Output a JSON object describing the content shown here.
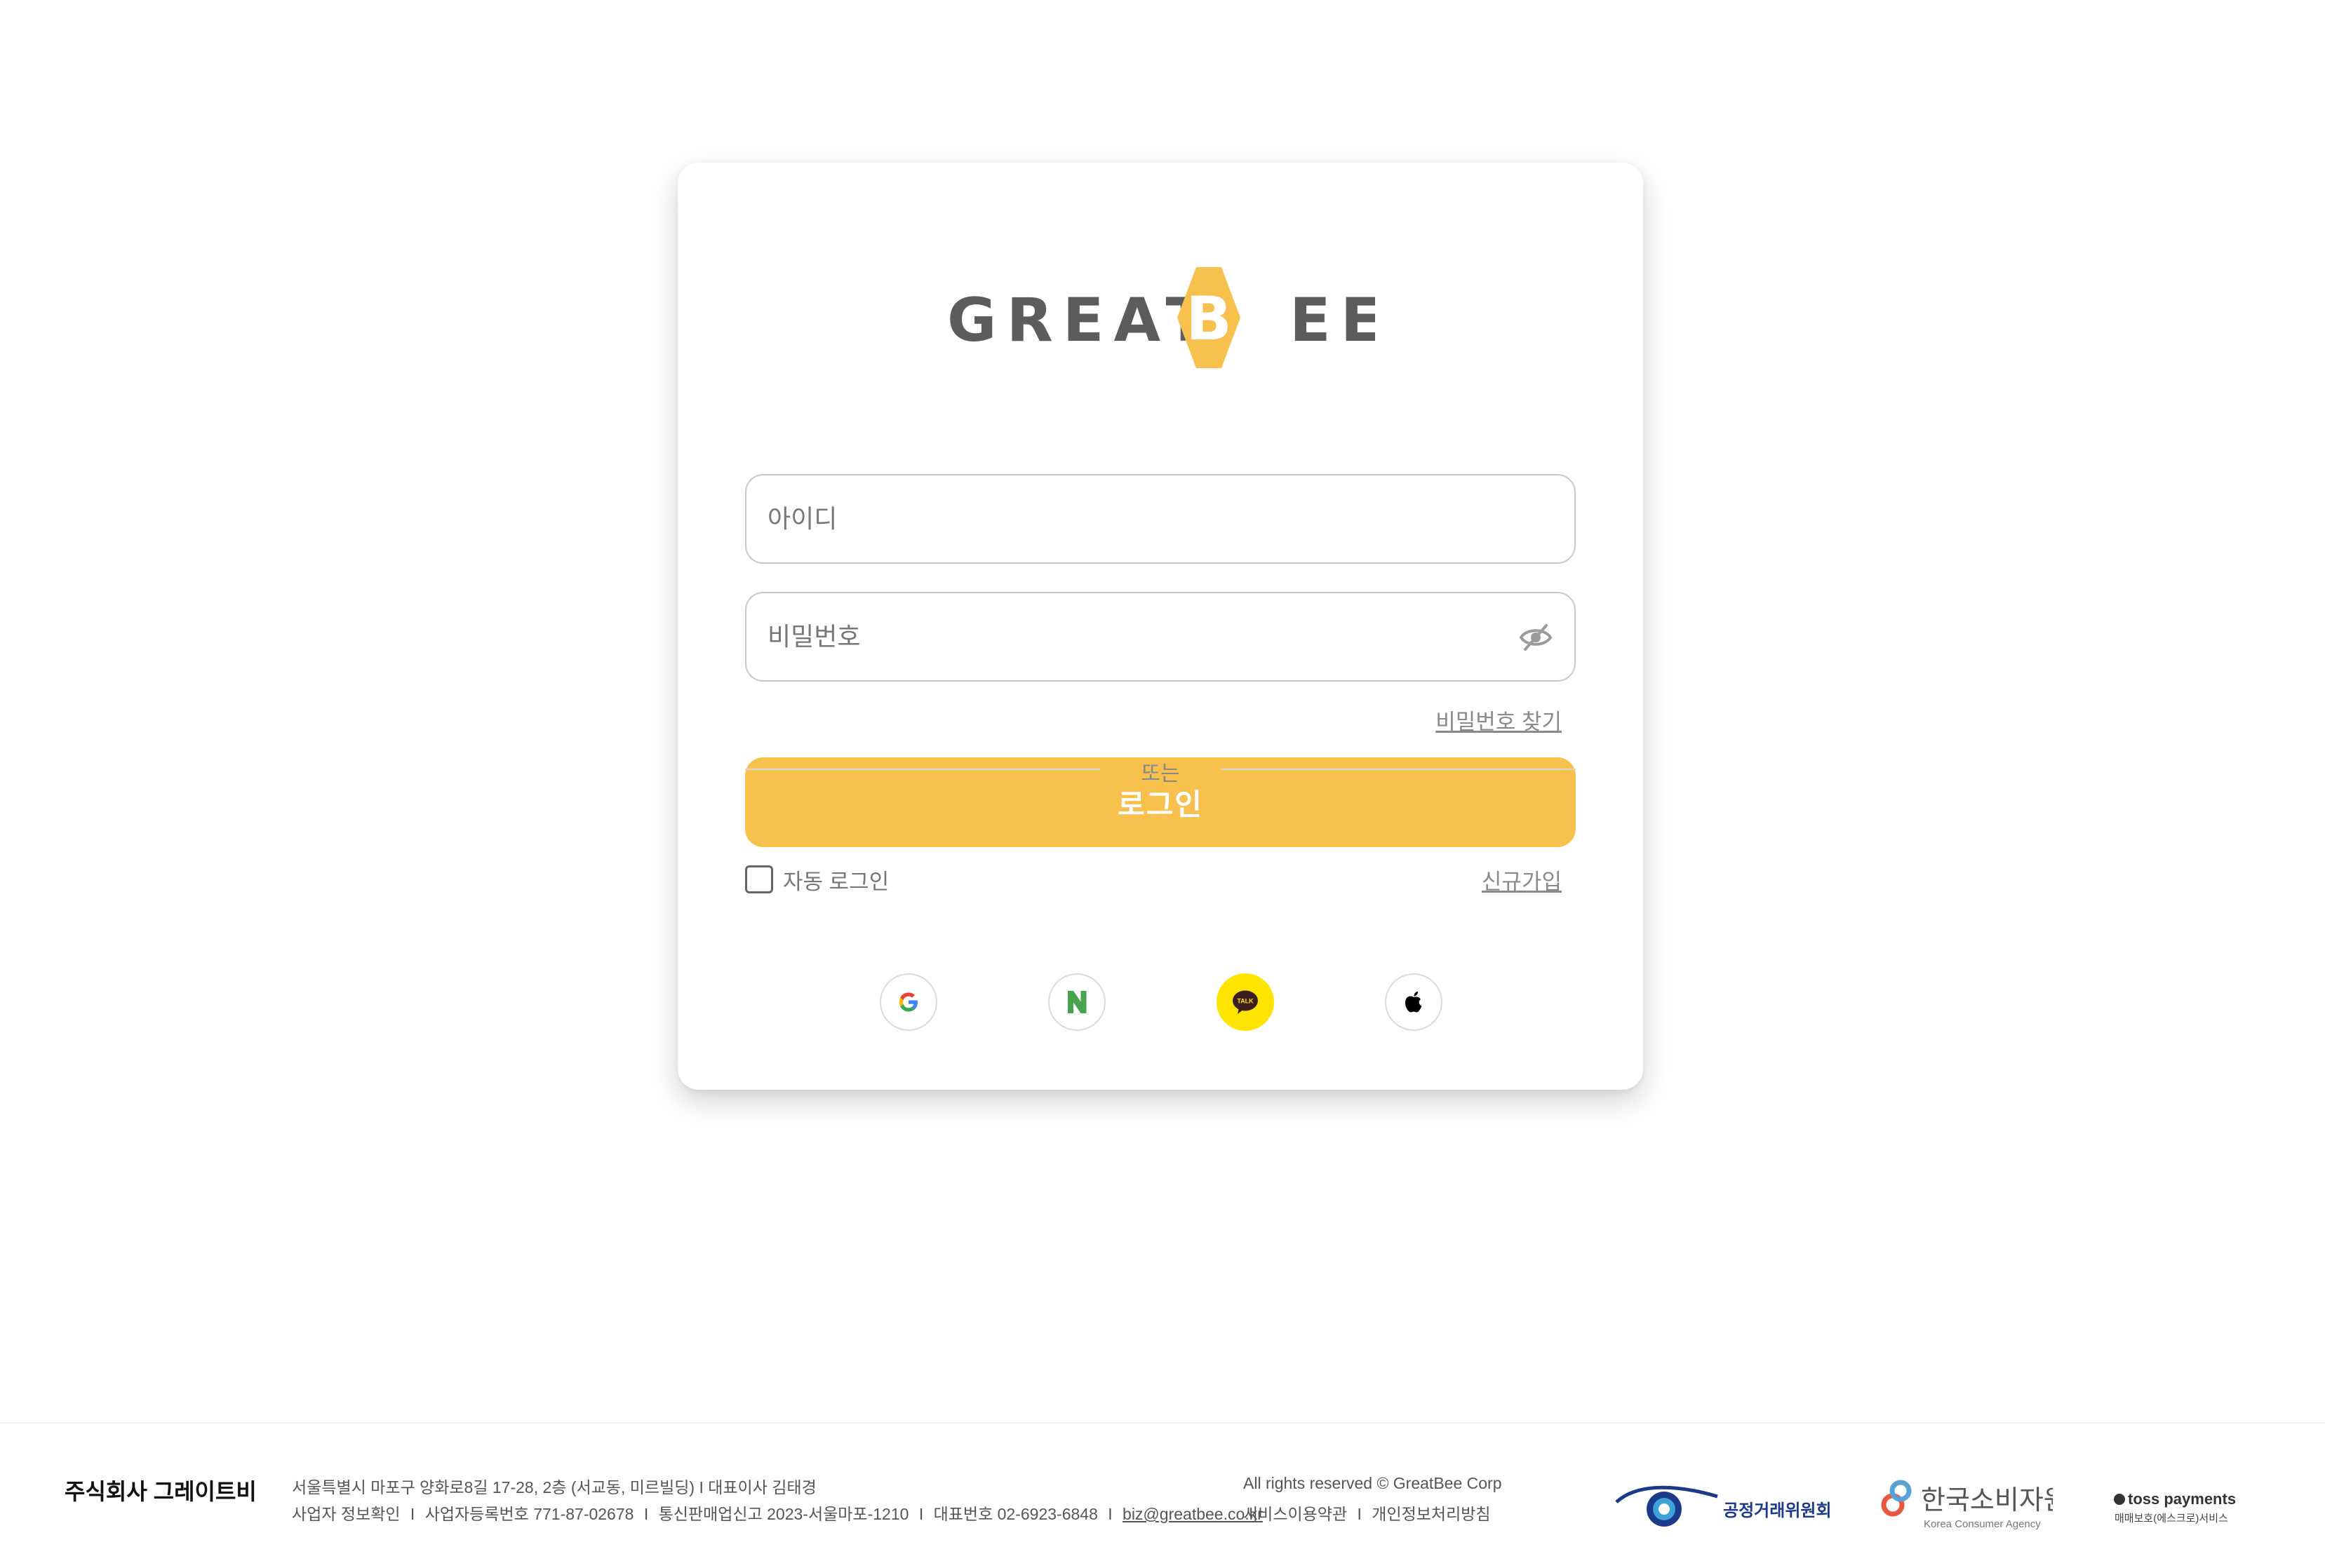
{
  "brand": {
    "logo_text_left": "GREAT",
    "logo_letter": "B",
    "logo_text_right": "EE",
    "accent_color": "#f8c04c",
    "text_color": "#5c5c5c"
  },
  "login_form": {
    "id_placeholder": "아이디",
    "id_value": "",
    "password_placeholder": "비밀번호",
    "password_value": "",
    "password_toggle_icon": "eye-off-icon",
    "find_password_label": "비밀번호 찾기",
    "login_button_label": "로그인",
    "auto_login_label": "자동 로그인",
    "auto_login_checked": false,
    "signup_label": "신규가입",
    "divider_text": "또는"
  },
  "social_login": [
    {
      "provider": "google",
      "icon": "google-icon"
    },
    {
      "provider": "naver",
      "icon": "naver-icon",
      "letter": "N"
    },
    {
      "provider": "kakao",
      "icon": "kakaotalk-icon",
      "letter": "TALK"
    },
    {
      "provider": "apple",
      "icon": "apple-icon"
    }
  ],
  "footer": {
    "company_name": "주식회사 그레이트비",
    "address_line": "서울특별시 마포구 양화로8길 17-28, 2층 (서교동, 미르빌딩) I 대표이사 김태경",
    "biz_info_link": "사업자 정보확인",
    "reg_number": "사업자등록번호 771-87-02678",
    "mail_order_report": "통신판매업신고 2023-서울마포-1210",
    "phone": "대표번호 02-6923-6848",
    "email": "biz@greatbee.co.kr",
    "separator": "I",
    "copyright": "All rights reserved © GreatBee Corp",
    "terms_label": "서비스이용약관",
    "privacy_label": "개인정보처리방침",
    "badges": {
      "ftc": "공정거래위원회",
      "kca": "한국소비자원",
      "kca_sub": "Korea Consumer Agency",
      "toss": "toss payments",
      "toss_sub": "매매보호(에스크로)서비스"
    }
  }
}
